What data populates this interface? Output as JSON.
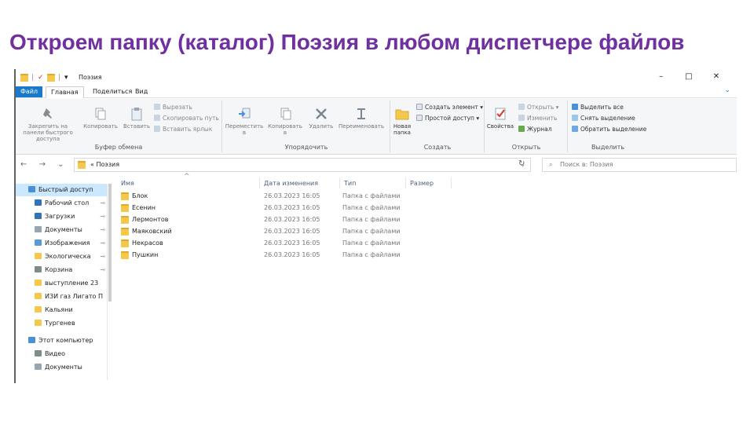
{
  "slide": {
    "title": "Откроем папку (каталог) Поэзия в любом диспетчере файлов"
  },
  "window": {
    "title": "Поэзия",
    "quick_access_toolbar": [
      "|",
      "✓",
      "|",
      "▾"
    ],
    "controls": {
      "minimize": "–",
      "maximize": "□",
      "close": "✕"
    }
  },
  "tabs": [
    {
      "label": "Файл",
      "active": false
    },
    {
      "label": "Главная",
      "active": true
    },
    {
      "label": "Поделиться",
      "active": false
    },
    {
      "label": "Вид",
      "active": false
    }
  ],
  "help_icon": "⌄",
  "ribbon": {
    "clipboard": {
      "label": "Буфер обмена",
      "pin_label": "Закрепить на панели быстрого доступа",
      "copy_label": "Копировать",
      "paste_label": "Вставить",
      "cut_label": "Вырезать",
      "copy_path_label": "Скопировать путь",
      "paste_shortcut_label": "Вставить ярлык"
    },
    "organize": {
      "label": "Упорядочить",
      "move_to_label": "Переместить в",
      "copy_to_label": "Копировать в",
      "delete_label": "Удалить",
      "rename_label": "Переименовать"
    },
    "create": {
      "label": "Создать",
      "new_folder_label": "Новая папка",
      "new_item_label": "Создать элемент ▾",
      "easy_access_label": "Простой доступ ▾"
    },
    "open": {
      "label": "Открыть",
      "properties_label": "Свойства",
      "open_label": "Открыть ▾",
      "edit_label": "Изменить",
      "history_label": "Журнал"
    },
    "select": {
      "label": "Выделить",
      "select_all_label": "Выделить все",
      "select_none_label": "Снять выделение",
      "invert_label": "Обратить выделение"
    }
  },
  "address": {
    "path": "« Поэзия",
    "separator": "›",
    "dropdown": "⌄",
    "refresh": "↻",
    "search_placeholder": "Поиск в: Поэзия"
  },
  "nav": {
    "back": "←",
    "forward": "→",
    "recent": "⌄",
    "up": "↑",
    "items": [
      {
        "label": "Быстрый доступ",
        "icon": "star-icon",
        "pinned": false,
        "selected": true
      },
      {
        "label": "Рабочий стол",
        "icon": "desktop-icon",
        "pinned": true
      },
      {
        "label": "Загрузки",
        "icon": "download-icon",
        "pinned": true
      },
      {
        "label": "Документы",
        "icon": "documents-icon",
        "pinned": true
      },
      {
        "label": "Изображения",
        "icon": "pictures-icon",
        "pinned": true
      },
      {
        "label": "Экологическа",
        "icon": "folder-icon",
        "pinned": true
      },
      {
        "label": "Корзина",
        "icon": "recycle-bin-icon",
        "pinned": true
      },
      {
        "label": "выступление 23",
        "icon": "folder-icon",
        "pinned": false
      },
      {
        "label": "ИЗИ газ Лигато П",
        "icon": "folder-icon",
        "pinned": false
      },
      {
        "label": "Кальяни",
        "icon": "folder-icon",
        "pinned": false
      },
      {
        "label": "Тургенев",
        "icon": "folder-icon",
        "pinned": false
      },
      {
        "label": "Этот компьютер",
        "icon": "computer-icon",
        "pinned": false
      },
      {
        "label": "Видео",
        "icon": "video-icon",
        "pinned": false
      },
      {
        "label": "Документы",
        "icon": "documents-icon",
        "pinned": false
      }
    ],
    "pin_glyph": "⊸"
  },
  "files": {
    "columns": {
      "name": "Имя",
      "date": "Дата изменения",
      "type": "Тип",
      "size": "Размер"
    },
    "sort_arrow": "^",
    "rows": [
      {
        "name": "Блок",
        "date": "26.03.2023 16:05",
        "type": "Папка с файлами"
      },
      {
        "name": "Есенин",
        "date": "26.03.2023 16:05",
        "type": "Папка с файлами"
      },
      {
        "name": "Лермонтов",
        "date": "26.03.2023 16:05",
        "type": "Папка с файлами"
      },
      {
        "name": "Маяковский",
        "date": "26.03.2023 16:05",
        "type": "Папка с файлами"
      },
      {
        "name": "Некрасов",
        "date": "26.03.2023 16:05",
        "type": "Папка с файлами"
      },
      {
        "name": "Пушкин",
        "date": "26.03.2023 16:05",
        "type": "Папка с файлами"
      }
    ]
  },
  "colors": {
    "title": "#7030a0",
    "file_tab": "#1979ca",
    "selection": "#cce8ff",
    "folder": "#f4c84a"
  }
}
